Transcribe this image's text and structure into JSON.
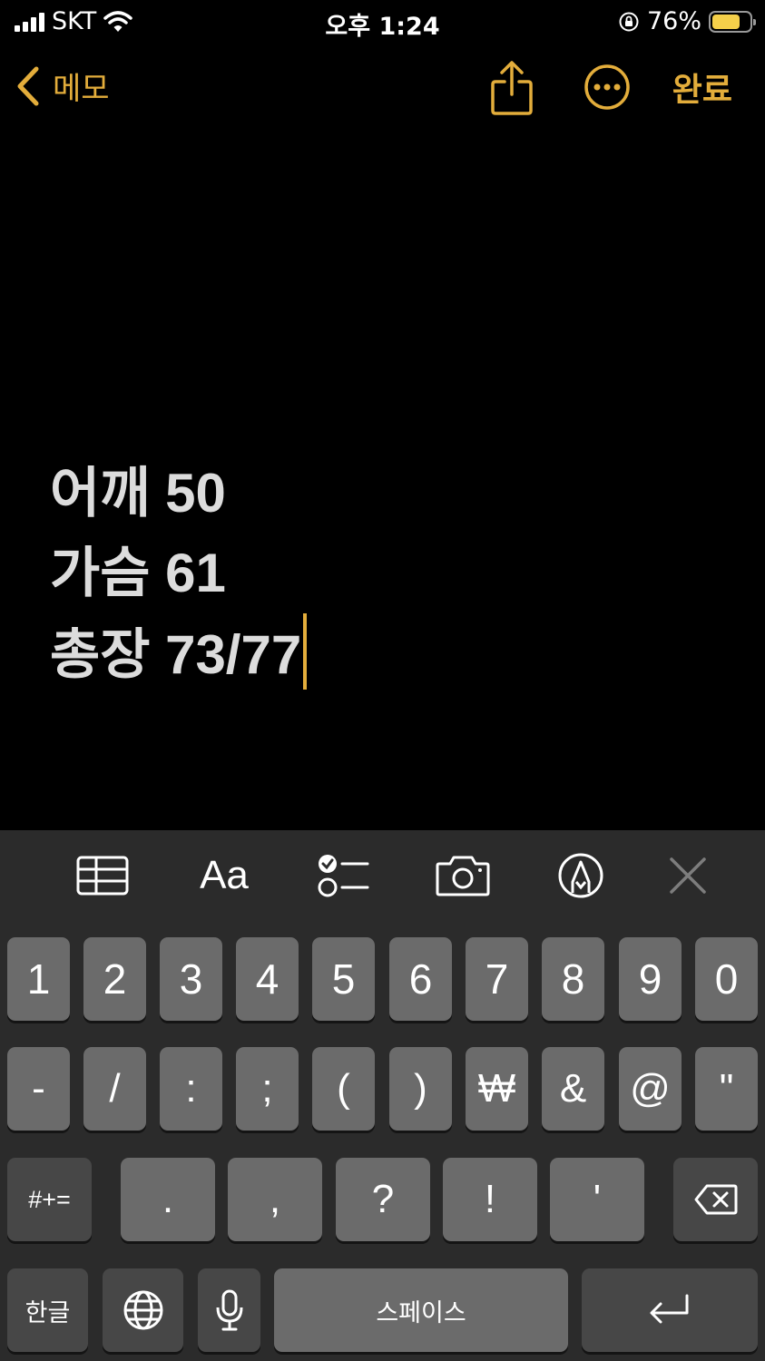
{
  "status_bar": {
    "carrier": "SKT",
    "time": "오후 1:24",
    "battery_percent": "76%",
    "battery_level": 0.76,
    "battery_color": "#f5d04a"
  },
  "nav": {
    "back_label": "메모",
    "done_label": "완료",
    "accent": "#e3ad3b",
    "icons": [
      "chevron-left-icon",
      "share-icon",
      "more-icon"
    ]
  },
  "note": {
    "lines": [
      "어깨 50",
      "가슴 61",
      "총장 73/77"
    ],
    "cursor_color": "#e3ad3b"
  },
  "toolbar": {
    "aa_label": "Aa",
    "icons": [
      "table-icon",
      "text-format-icon",
      "checklist-icon",
      "camera-icon",
      "markup-icon",
      "close-icon"
    ]
  },
  "keyboard": {
    "row1": [
      "1",
      "2",
      "3",
      "4",
      "5",
      "6",
      "7",
      "8",
      "9",
      "0"
    ],
    "row2": [
      "-",
      "/",
      ":",
      ";",
      "(",
      ")",
      "₩",
      "&",
      "@",
      "\""
    ],
    "row3_shift": "#+=",
    "row3": [
      ".",
      ",",
      "?",
      "!",
      "'"
    ],
    "lang": "한글",
    "space": "스페이스"
  }
}
